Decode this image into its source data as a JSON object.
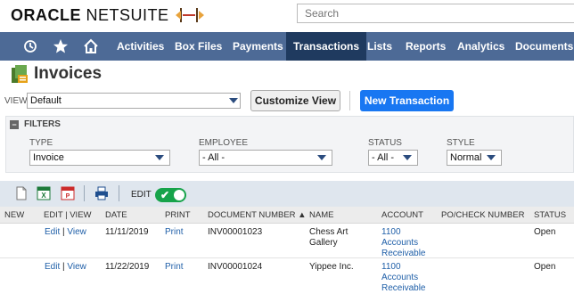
{
  "header": {
    "brand_bold": "ORACLE",
    "brand_light": "NETSUITE",
    "search_placeholder": "Search"
  },
  "nav": {
    "icons": [
      "history-icon",
      "star-icon",
      "home-icon"
    ],
    "items": [
      "Activities",
      "Box Files",
      "Payments",
      "Transactions",
      "Lists",
      "Reports",
      "Analytics",
      "Documents"
    ],
    "active": "Transactions"
  },
  "page": {
    "title": "Invoices"
  },
  "view": {
    "label": "VIEW",
    "value": "Default",
    "customize_label": "Customize View",
    "new_label": "New Transaction"
  },
  "filters": {
    "title": "FILTERS",
    "type_label": "TYPE",
    "type_value": "Invoice",
    "employee_label": "EMPLOYEE",
    "employee_value": "- All -",
    "status_label": "STATUS",
    "status_value": "- All -",
    "style_label": "STYLE",
    "style_value": "Normal"
  },
  "toolbar": {
    "edit_label": "EDIT",
    "edit_on": true
  },
  "table": {
    "headers": {
      "new": "NEW",
      "edit_view": "EDIT | VIEW",
      "date": "DATE",
      "print": "PRINT",
      "doc": "DOCUMENT NUMBER ▲",
      "name": "NAME",
      "account": "ACCOUNT",
      "po": "PO/CHECK NUMBER",
      "status": "STATUS"
    },
    "rows": [
      {
        "edit": "Edit",
        "view": "View",
        "date": "11/11/2019",
        "print": "Print",
        "doc": "INV00001023",
        "name1": "Chess Art",
        "name2": "Gallery",
        "acc1": "1100",
        "acc2": "Accounts",
        "acc3": "Receivable",
        "status": "Open"
      },
      {
        "edit": "Edit",
        "view": "View",
        "date": "11/22/2019",
        "print": "Print",
        "doc": "INV00001024",
        "name1": "Yippee Inc.",
        "name2": "",
        "acc1": "1100",
        "acc2": "Accounts",
        "acc3": "Receivable",
        "status": "Open"
      }
    ]
  },
  "colors": {
    "nav_bg": "#4d6a96",
    "nav_active": "#1f3a5f",
    "primary_button": "#1877f2",
    "link": "#1f5fa8",
    "toggle_on": "#16a34a"
  }
}
